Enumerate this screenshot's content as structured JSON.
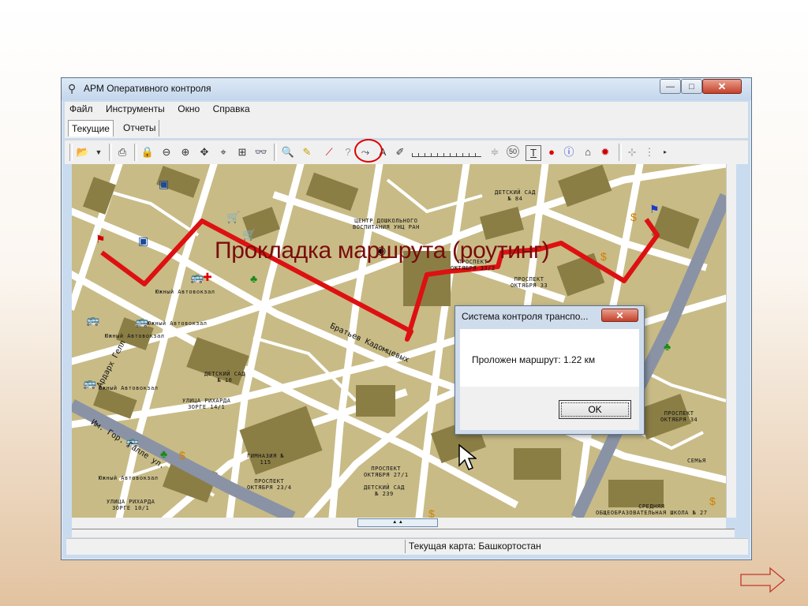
{
  "window": {
    "title": "АРМ Оперативного контроля",
    "controls": {
      "minimize": "—",
      "maximize": "□",
      "close": "✕"
    }
  },
  "menu": [
    "Файл",
    "Инструменты",
    "Окно",
    "Справка"
  ],
  "tabs": {
    "current": "Текущие",
    "reports": "Отчеты"
  },
  "toolbar": {
    "highlight_color": "#e00000",
    "icons": [
      "open-folder-icon",
      "chevron-down-icon",
      "printer-icon",
      "lock-icon",
      "zoom-out-icon",
      "zoom-in-icon",
      "pan-icon",
      "center-icon",
      "grid-icon",
      "binoculars-icon",
      "magnifier-icon",
      "pencil-icon",
      "route-icon",
      "help-icon",
      "measure-icon",
      "text-icon",
      "eraser-icon",
      "speed-limit-icon",
      "text-tool-icon",
      "layers-icon",
      "info-icon",
      "house-icon",
      "marker-icon"
    ],
    "speed_limit": "50",
    "text_tool": "T"
  },
  "caption": "Прокладка маршрута (роутинг)",
  "map": {
    "route_color": "#dd1111",
    "streets": {
      "bratyev": "Братьев Кадомцевых",
      "galle": "Им. Гор. Галле ул.",
      "letters": "Ардарх Гелл"
    },
    "labels": {
      "kindergarten_84": "ДЕТСКИЙ САД\n№ 84",
      "center": "ЦЕНТР ДОШКОЛЬНОГО\nВОСПИТАНИЯ УНЦ РАН",
      "prospekt_33_2": "ПРОСПЕКТ\nОКТЯБРЯ 33/2",
      "prospekt_33": "ПРОСПЕКТ\nОКТЯБРЯ 33",
      "yuzhny_1": "Южный Автовокзал",
      "yuzhny_2": "Южный Автовокзал",
      "yuzhny_3": "Южный Автовокзал",
      "yuzhny_4": "Южный Автовокзал",
      "yuzhny_5": "Южный Автовокзал",
      "kindergarten_10": "ДЕТСКИЙ САД\n№ 10",
      "zorge_14": "УЛИЦА РИХАРДА\nЗОРГЕ 14/1",
      "gymnasium": "ГИМНАЗИЯ №\n115",
      "prospekt_23": "ПРОСПЕКТ\nОКТЯБРЯ 23/4",
      "zorge_10": "УЛИЦА РИХАРДА\nЗОРГЕ 10/1",
      "prospekt_27": "ПРОСПЕКТ\nОКТЯБРЯ 27/1",
      "kindergarten_239": "ДЕТСКИЙ САД\n№ 239",
      "prospekt_34": "ПРОСПЕКТ\nОКТЯБРЯ 34",
      "semya": "СЕМЬЯ",
      "school_27": "СРЕДНЯЯ\nОБЩЕОБРАЗОВАТЕЛЬНАЯ ШКОЛА № 27"
    }
  },
  "dialog": {
    "title": "Система контроля транспо...",
    "message": "Проложен маршрут: 1.22 км",
    "ok": "OK",
    "close": "✕"
  },
  "status": {
    "map": "Текущая карта: Башкортостан"
  }
}
